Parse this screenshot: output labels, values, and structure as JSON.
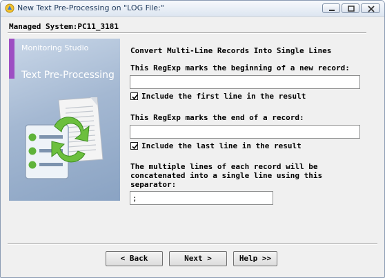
{
  "window": {
    "title": "New Text Pre-Processing on \"LOG File:\"",
    "controls": {
      "minimize_icon": "minimize-icon",
      "maximize_icon": "maximize-icon",
      "close_icon": "close-icon"
    }
  },
  "header": {
    "managed_system": "Managed System:PC11_3181"
  },
  "banner": {
    "product": "Monitoring Studio",
    "title": "Text Pre-Processing",
    "accent_color": "#9d4fc3"
  },
  "form": {
    "heading": "Convert Multi-Line Records Into Single Lines",
    "begin_label": "This RegExp marks the beginning of a new record:",
    "begin_value": "",
    "include_first_label": "Include the first line in the result",
    "include_first_checked": true,
    "end_label": "This RegExp marks the end of a record:",
    "end_value": "",
    "include_last_label": "Include the last line in the result",
    "include_last_checked": true,
    "separator_label_1": "The multiple lines of each record will be",
    "separator_label_2": "concatenated into a single line using this",
    "separator_label_3": "separator:",
    "separator_value": ";"
  },
  "buttons": {
    "back": "< Back",
    "next": "Next >",
    "help": "Help >>"
  }
}
